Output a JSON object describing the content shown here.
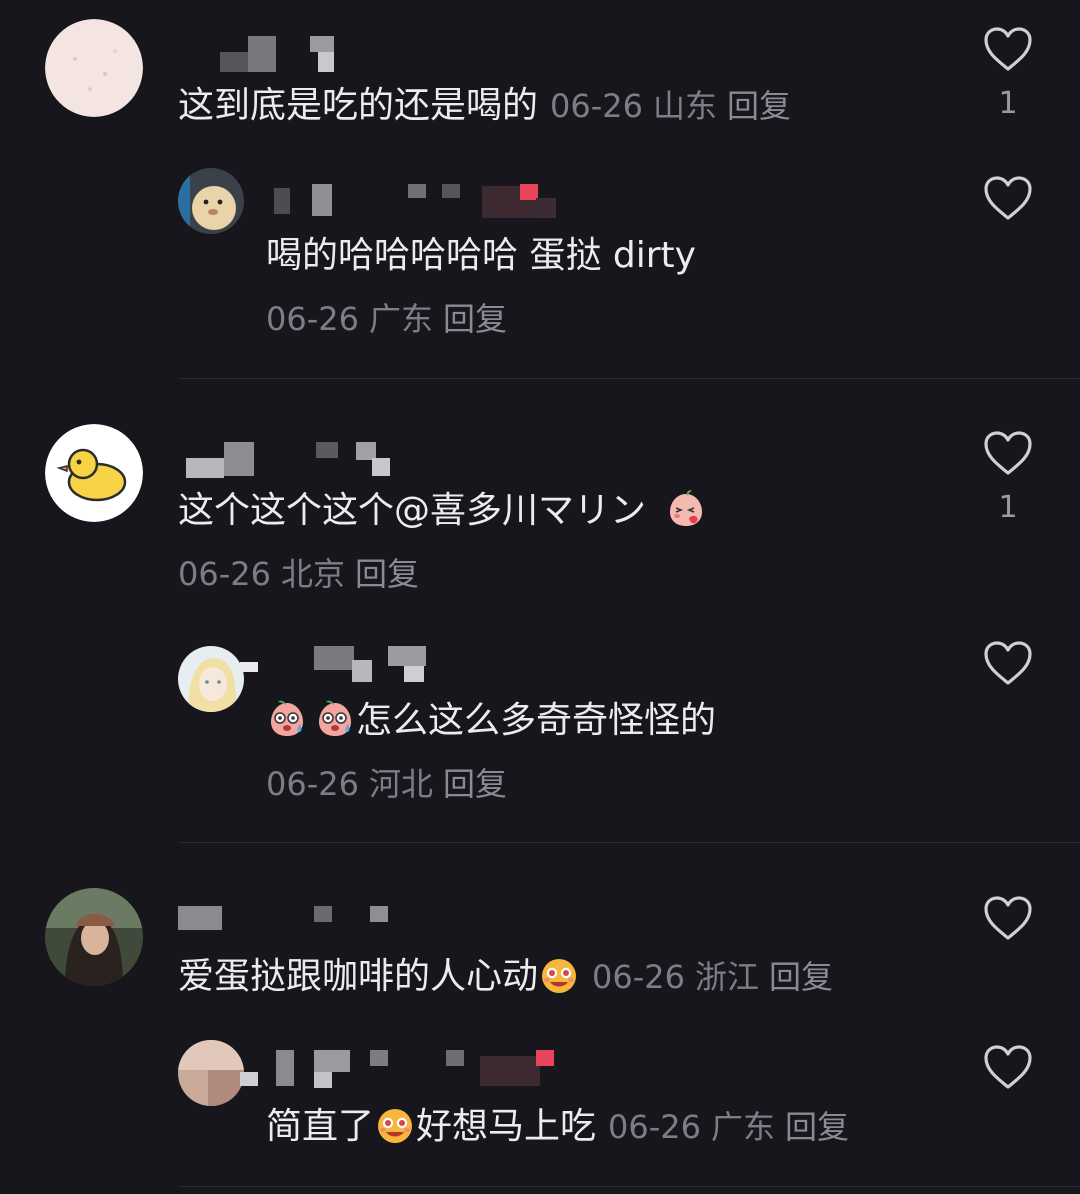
{
  "comments": [
    {
      "text": "这到底是吃的还是喝的",
      "date": "06-26",
      "location": "山东",
      "reply_label": "回复",
      "likes": "1",
      "replies": [
        {
          "text": "喝的哈哈哈哈哈 蛋挞 dirty",
          "date": "06-26",
          "location": "广东",
          "reply_label": "回复"
        }
      ]
    },
    {
      "text_before": "这个这个这个",
      "mention": "@喜多川マリン",
      "date": "06-26",
      "location": "北京",
      "reply_label": "回复",
      "likes": "1",
      "replies": [
        {
          "text": "怎么这么多奇奇怪怪的",
          "date": "06-26",
          "location": "河北",
          "reply_label": "回复"
        }
      ]
    },
    {
      "text": "爱蛋挞跟咖啡的人心动",
      "date": "06-26",
      "location": "浙江",
      "reply_label": "回复",
      "replies": [
        {
          "text_before": "简直了",
          "text_after": "好想马上吃",
          "date": "06-26",
          "location": "广东",
          "reply_label": "回复"
        }
      ]
    }
  ],
  "icons": {
    "like": "heart-outline-icon",
    "emoji_blush": "peach-blush-emoji",
    "emoji_sweat": "peach-sweat-emoji",
    "emoji_drool": "drooling-emoji"
  },
  "colors": {
    "background": "#16161c",
    "text": "#ececf0",
    "meta": "#7d7d85"
  }
}
